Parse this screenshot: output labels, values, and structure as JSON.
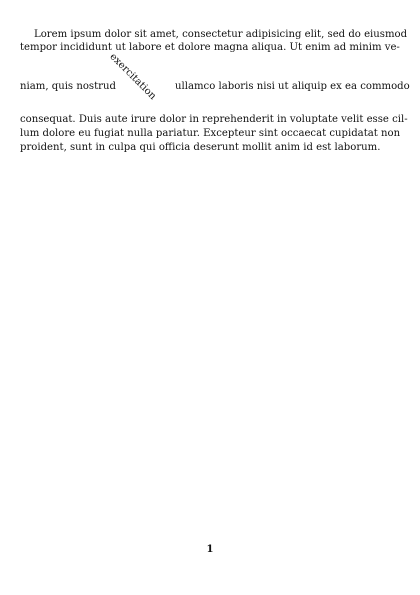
{
  "document": {
    "paragraph": {
      "line_1": "Lorem ipsum dolor sit amet, consectetur adipisicing elit, sed do eiusmod",
      "line_2": "tempor incididunt ut labore et dolore magna aliqua. Ut enim ad minim ve-",
      "line_3_left": "niam, quis nostrud",
      "rotated_word": "exercitation",
      "line_3_right": "ullamco laboris nisi ut aliquip ex ea commodo",
      "line_4": "consequat. Duis aute irure dolor in reprehenderit in voluptate velit esse cil-",
      "line_5": "lum dolore eu fugiat nulla pariatur. Excepteur sint occaecat cupidatat non",
      "line_6": "proident, sunt in culpa qui officia deserunt mollit anim id est laborum."
    },
    "page_number": "1"
  }
}
